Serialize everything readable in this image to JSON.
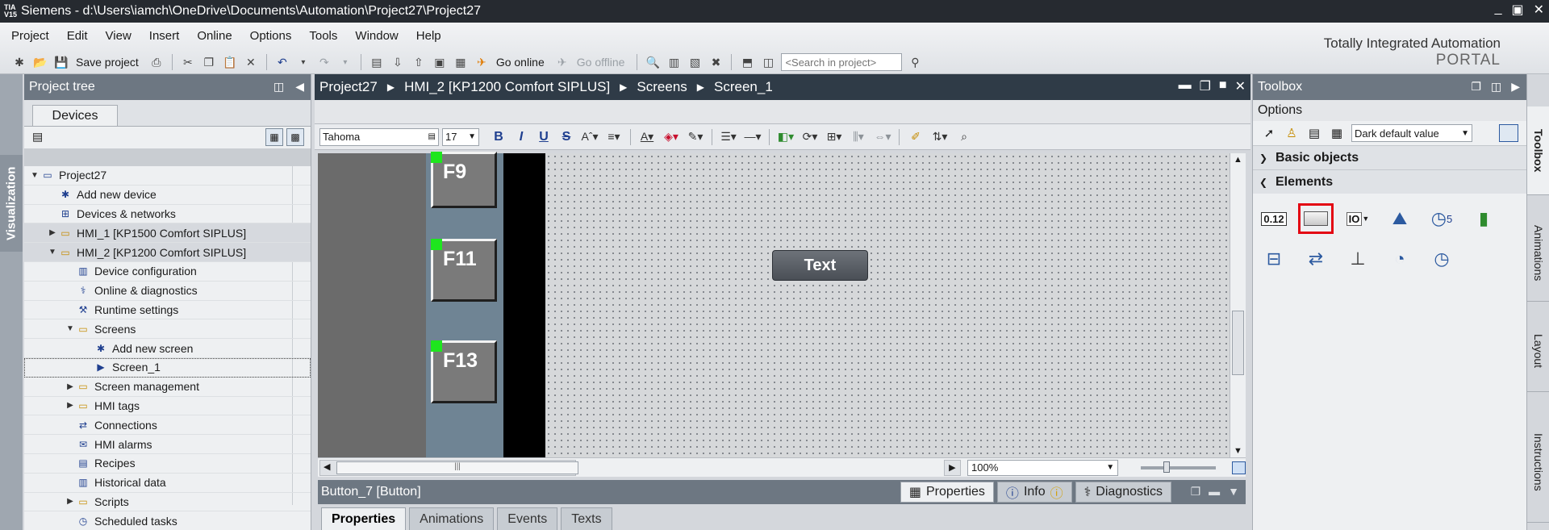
{
  "titlebar": {
    "logo_line1": "TIA",
    "logo_line2": "V15",
    "title": "Siemens  -  d:\\Users\\iamch\\OneDrive\\Documents\\Automation\\Project27\\Project27",
    "minimize": "_",
    "restore": "▣",
    "close": "✕"
  },
  "menu": {
    "items": [
      "Project",
      "Edit",
      "View",
      "Insert",
      "Online",
      "Options",
      "Tools",
      "Window",
      "Help"
    ]
  },
  "branding": {
    "line1": "Totally Integrated Automation",
    "line2": "PORTAL"
  },
  "toolbar": {
    "save_label": "Save project",
    "go_online_label": "Go online",
    "go_offline_label": "Go offline",
    "search_placeholder": "<Search in project>"
  },
  "left_strip": {
    "tab_label": "Visualization"
  },
  "project_tree": {
    "title": "Project tree",
    "tab_label": "Devices",
    "items": [
      {
        "label": "Project27",
        "indent": 0,
        "arrow": "down",
        "icon": "project-icon"
      },
      {
        "label": "Add new device",
        "indent": 1,
        "arrow": "",
        "icon": "add-device-icon"
      },
      {
        "label": "Devices & networks",
        "indent": 1,
        "arrow": "",
        "icon": "network-icon"
      },
      {
        "label": "HMI_1 [KP1500 Comfort SIPLUS]",
        "indent": 1,
        "arrow": "right",
        "icon": "folder-icon",
        "highlight": true
      },
      {
        "label": "HMI_2 [KP1200 Comfort SIPLUS]",
        "indent": 1,
        "arrow": "down",
        "icon": "folder-icon",
        "highlight": true
      },
      {
        "label": "Device configuration",
        "indent": 2,
        "arrow": "",
        "icon": "device-config-icon"
      },
      {
        "label": "Online & diagnostics",
        "indent": 2,
        "arrow": "",
        "icon": "diagnostics-icon"
      },
      {
        "label": "Runtime settings",
        "indent": 2,
        "arrow": "",
        "icon": "wrench-icon"
      },
      {
        "label": "Screens",
        "indent": 2,
        "arrow": "down",
        "icon": "folder-open-icon"
      },
      {
        "label": "Add new screen",
        "indent": 3,
        "arrow": "",
        "icon": "add-screen-icon"
      },
      {
        "label": "Screen_1",
        "indent": 3,
        "arrow": "",
        "icon": "screen-icon",
        "selected": true
      },
      {
        "label": "Screen management",
        "indent": 2,
        "arrow": "right",
        "icon": "folder-icon"
      },
      {
        "label": "HMI tags",
        "indent": 2,
        "arrow": "right",
        "icon": "folder-icon"
      },
      {
        "label": "Connections",
        "indent": 2,
        "arrow": "",
        "icon": "connections-icon"
      },
      {
        "label": "HMI alarms",
        "indent": 2,
        "arrow": "",
        "icon": "alarm-icon"
      },
      {
        "label": "Recipes",
        "indent": 2,
        "arrow": "",
        "icon": "recipe-icon"
      },
      {
        "label": "Historical data",
        "indent": 2,
        "arrow": "",
        "icon": "historical-icon"
      },
      {
        "label": "Scripts",
        "indent": 2,
        "arrow": "right",
        "icon": "folder-icon"
      },
      {
        "label": "Scheduled tasks",
        "indent": 2,
        "arrow": "",
        "icon": "tasks-icon"
      }
    ]
  },
  "editor": {
    "breadcrumb": [
      "Project27",
      "HMI_2 [KP1200 Comfort SIPLUS]",
      "Screens",
      "Screen_1"
    ],
    "font_name": "Tahoma",
    "font_size": "17",
    "bold": "B",
    "italic": "I",
    "underline": "U",
    "strike": "S",
    "canvas": {
      "fkeys": [
        "F9",
        "F11",
        "F13"
      ],
      "text_button": "Text"
    },
    "zoom": "100%"
  },
  "properties_panel": {
    "title": "Button_7 [Button]",
    "top_tabs": [
      "Properties",
      "Info",
      "Diagnostics"
    ],
    "sub_tabs": [
      "Properties",
      "Animations",
      "Events",
      "Texts"
    ]
  },
  "toolbox": {
    "title": "Toolbox",
    "options_label": "Options",
    "style_value": "Dark default value",
    "sections": {
      "basic_objects": "Basic objects",
      "elements": "Elements"
    },
    "elements_row1": {
      "io_field": "0.12",
      "button": "",
      "symbolic_io": "IO",
      "graphic_io": "",
      "date_time": "5",
      "bar": ""
    }
  },
  "right_strip": {
    "tabs": [
      "Toolbox",
      "Animations",
      "Layout",
      "Instructions"
    ]
  },
  "colors": {
    "header_dark": "#2f3b47",
    "panel_header": "#6d7782",
    "selection_red": "#e30613",
    "marker_green": "#1ee61e"
  }
}
